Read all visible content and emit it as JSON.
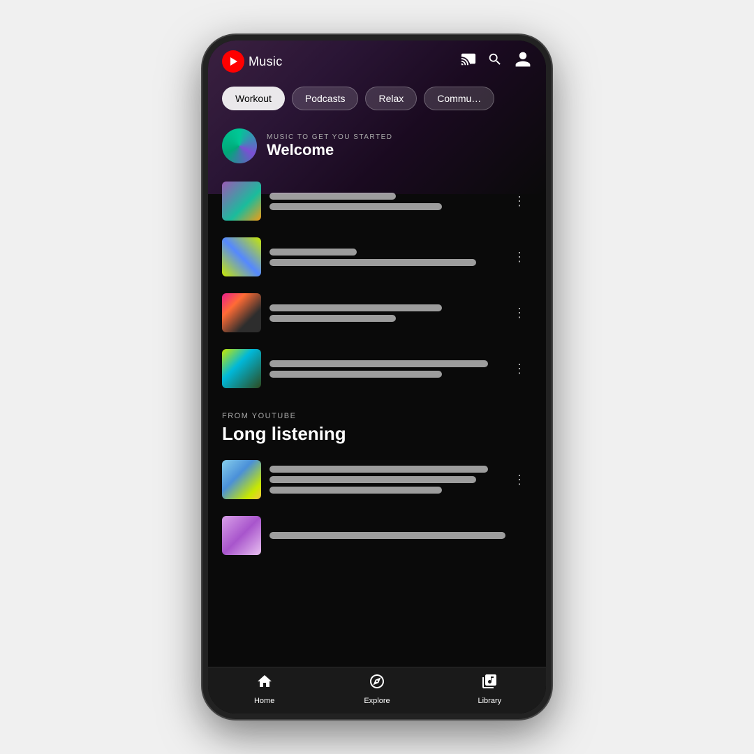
{
  "app": {
    "name": "Music"
  },
  "header": {
    "logo_text": "Music",
    "cast_label": "cast",
    "search_label": "search",
    "account_label": "account"
  },
  "chips": [
    {
      "label": "Workout",
      "active": true
    },
    {
      "label": "Podcasts",
      "active": false
    },
    {
      "label": "Relax",
      "active": false
    },
    {
      "label": "Commu…",
      "active": false
    }
  ],
  "sections": [
    {
      "id": "welcome",
      "section_label": "MUSIC TO GET YOU STARTED",
      "section_title": "Welcome",
      "has_avatar": true,
      "tracks": [
        {
          "line1_class": "short",
          "line2_class": "medium"
        },
        {
          "line1_class": "xshort",
          "line2_class": "long"
        },
        {
          "line1_class": "medium",
          "line2_class": "short"
        },
        {
          "line1_class": "xlong",
          "line2_class": "medium"
        }
      ]
    },
    {
      "id": "long-listening",
      "section_label": "FROM YOUTUBE",
      "section_title": "Long listening",
      "has_avatar": false,
      "tracks": [
        {
          "line1_class": "xlong",
          "line2_class": "long",
          "line3_class": "medium"
        },
        {
          "line1_class": "xlong",
          "line2_class": "medium"
        }
      ]
    }
  ],
  "bottom_nav": [
    {
      "id": "home",
      "label": "Home",
      "icon": "🏠"
    },
    {
      "id": "explore",
      "label": "Explore",
      "icon": "🧭"
    },
    {
      "id": "library",
      "label": "Library",
      "icon": "🎵"
    }
  ],
  "colors": {
    "background": "#0a0a0a",
    "accent": "#FF0000",
    "chip_active_bg": "rgba(255,255,255,0.9)",
    "chip_inactive_bg": "rgba(255,255,255,0.15)"
  }
}
